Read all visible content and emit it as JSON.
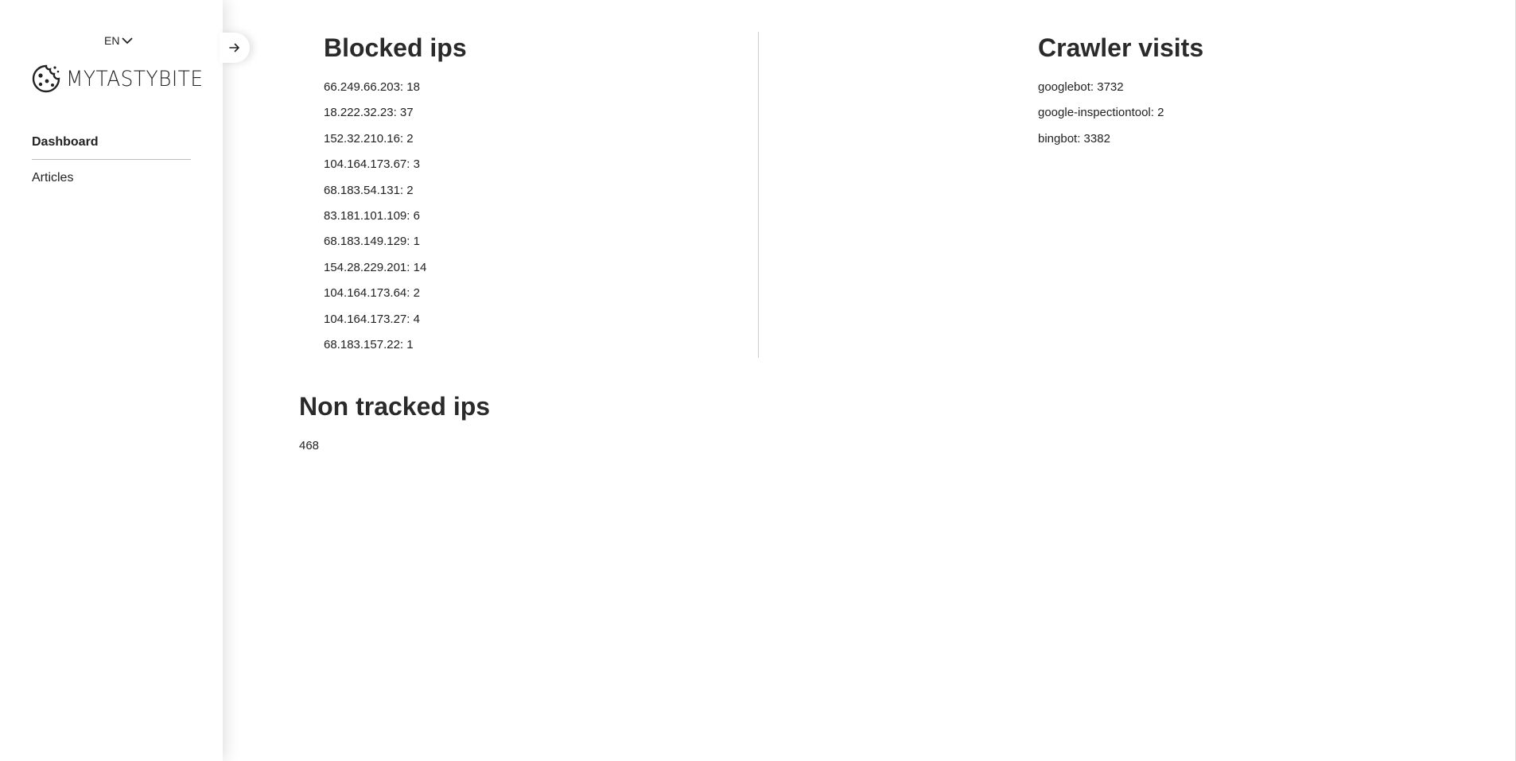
{
  "sidebar": {
    "language": "EN",
    "logo_text": "MYTASTYBITE",
    "nav": [
      {
        "label": "Dashboard",
        "active": true
      },
      {
        "label": "Articles",
        "active": false
      }
    ]
  },
  "blocked_ips": {
    "title": "Blocked ips",
    "items": [
      "66.249.66.203: 18",
      "18.222.32.23: 37",
      "152.32.210.16: 2",
      "104.164.173.67: 3",
      "68.183.54.131: 2",
      "83.181.101.109: 6",
      "68.183.149.129: 1",
      "154.28.229.201: 14",
      "104.164.173.64: 2",
      "104.164.173.27: 4",
      "68.183.157.22: 1"
    ]
  },
  "crawler_visits": {
    "title": "Crawler visits",
    "items": [
      "googlebot: 3732",
      "google-inspectiontool: 2",
      "bingbot: 3382"
    ]
  },
  "non_tracked": {
    "title": "Non tracked ips",
    "value": "468"
  },
  "icons": {
    "language_dropdown": "chevron-down-icon",
    "logo": "cookie-icon",
    "toggle": "arrow-right-icon"
  }
}
